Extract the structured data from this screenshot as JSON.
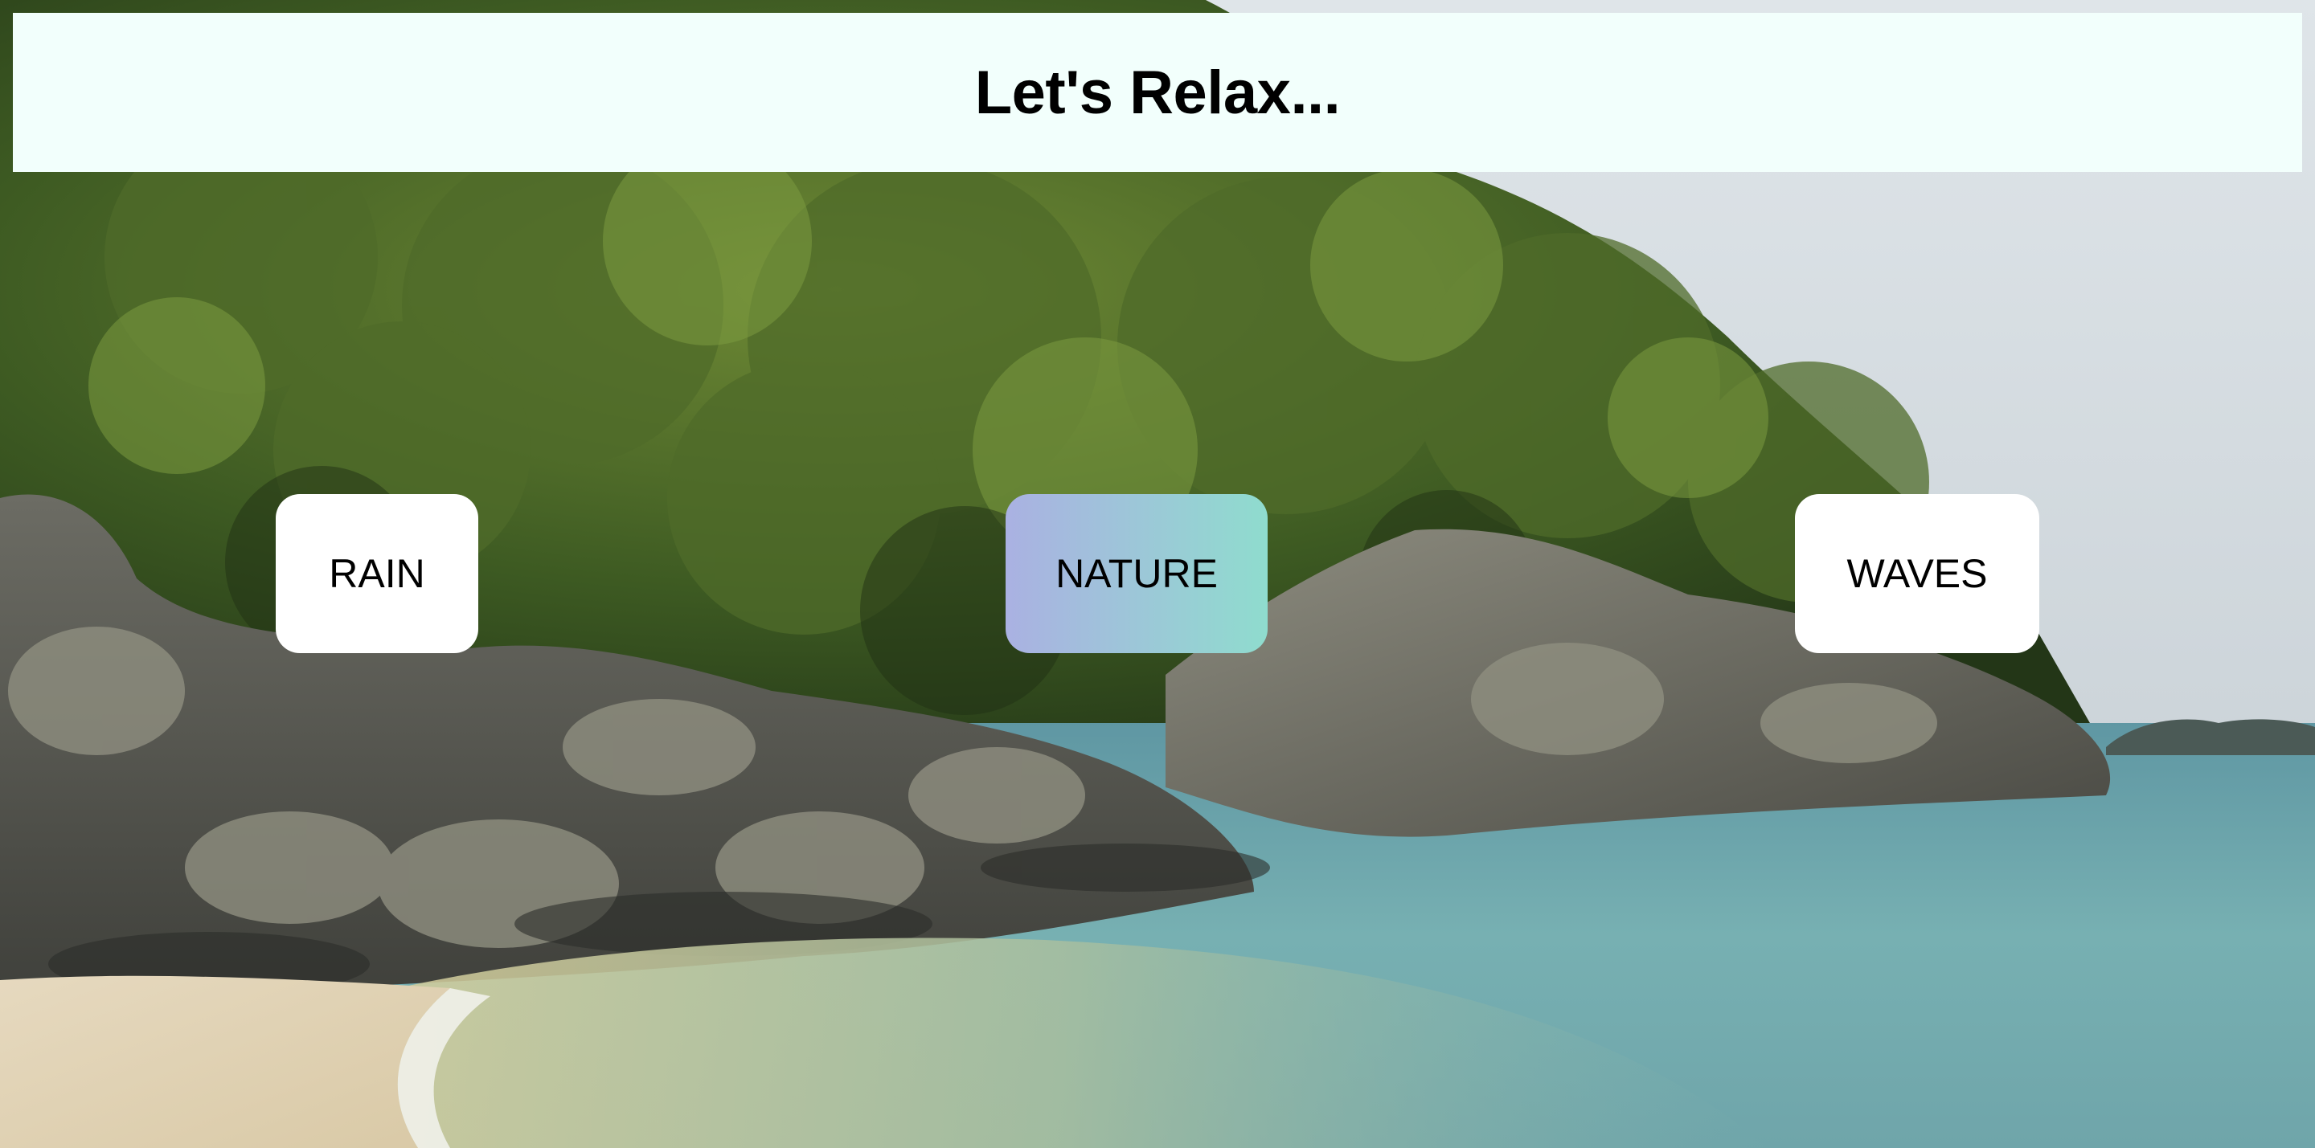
{
  "header": {
    "title": "Let's Relax..."
  },
  "sounds": [
    {
      "label": "RAIN",
      "active": false
    },
    {
      "label": "NATURE",
      "active": true
    },
    {
      "label": "WAVES",
      "active": false
    }
  ],
  "background": {
    "description_icon": "beach-scene-image"
  },
  "colors": {
    "header_bg": "#f2fffc",
    "button_bg": "#ffffff",
    "active_gradient_start": "#aab1e2",
    "active_gradient_end": "#8fdcce"
  }
}
